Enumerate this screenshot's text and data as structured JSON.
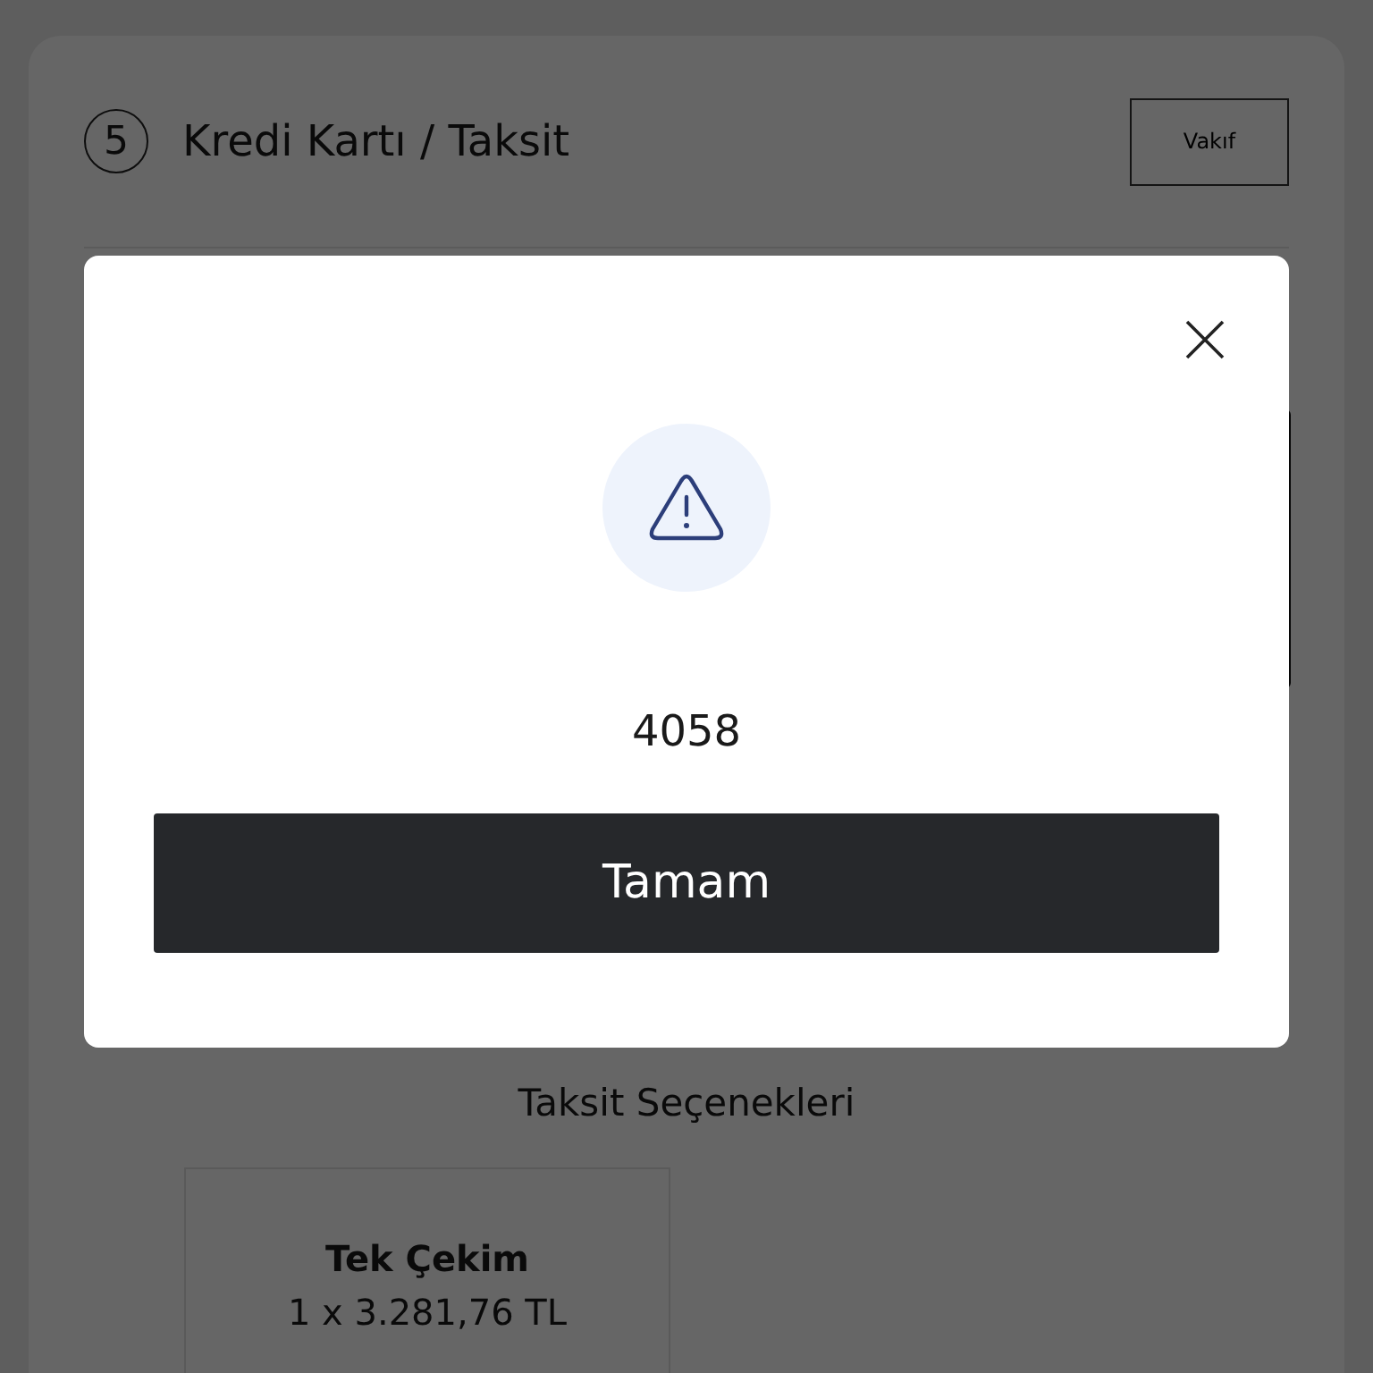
{
  "step": {
    "number": "5",
    "title": "Kredi Kartı / Taksit"
  },
  "bank_button": "Vakıf",
  "installments": {
    "title": "Taksit Seçenekleri",
    "options": [
      {
        "label": "Tek Çekim",
        "amount": "1 x 3.281,76 TL"
      }
    ]
  },
  "dialog": {
    "message": "4058",
    "button": "Tamam"
  }
}
